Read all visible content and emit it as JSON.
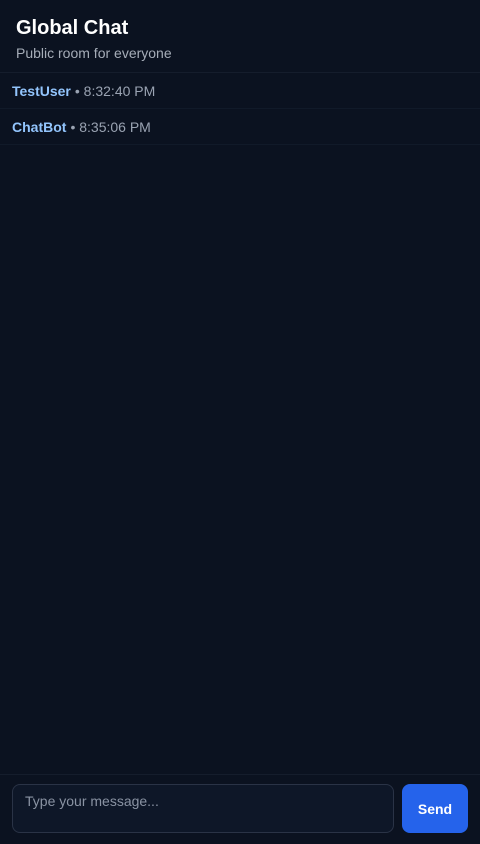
{
  "header": {
    "title": "Global Chat",
    "subtitle": "Public room for everyone"
  },
  "messages": [
    {
      "author": "TestUser",
      "meta": "• 8:32:40 PM"
    },
    {
      "author": "ChatBot",
      "meta": "• 8:35:06 PM"
    }
  ],
  "composer": {
    "placeholder": "Type your message...",
    "value": "",
    "send_label": "Send"
  },
  "colors": {
    "background": "#0b1220",
    "accent": "#2563eb",
    "author": "#93c5fd"
  }
}
